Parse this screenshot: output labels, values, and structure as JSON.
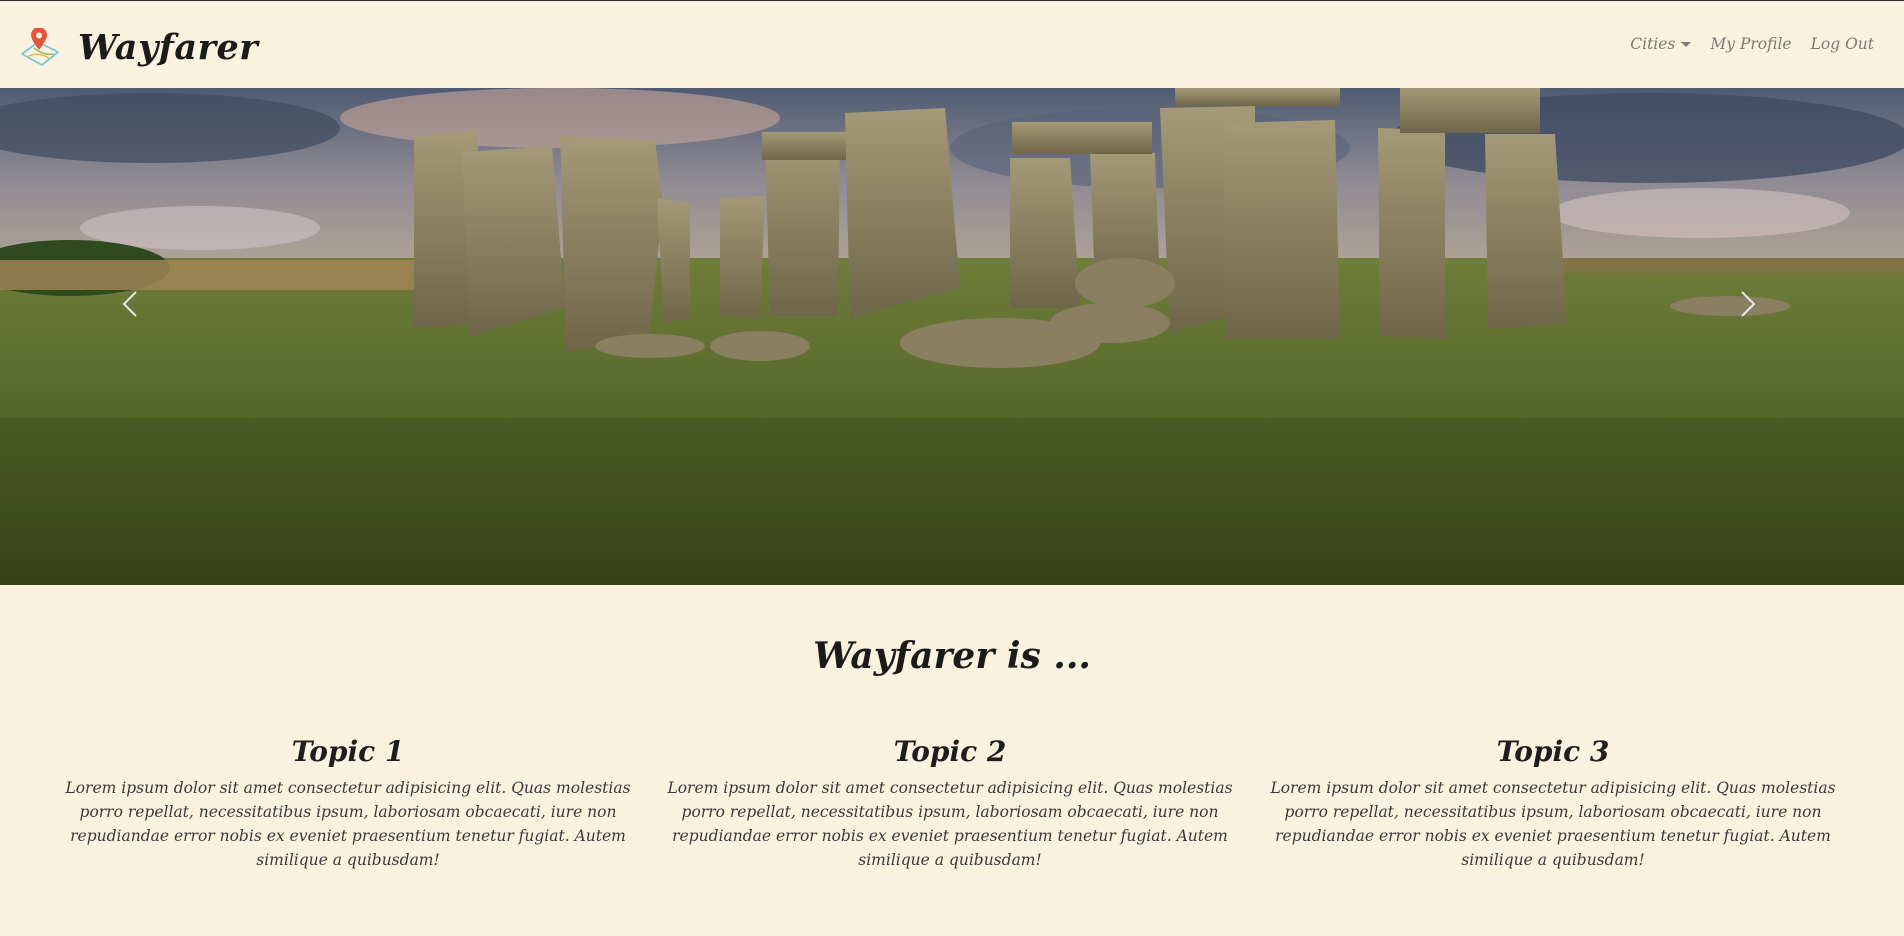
{
  "navbar": {
    "brand": "Wayfarer",
    "logo_icon": "map-pin-icon",
    "links": {
      "cities": "Cities",
      "profile": "My Profile",
      "logout": "Log Out"
    }
  },
  "carousel": {
    "image": "stonehenge-landscape",
    "prev_icon": "chevron-left-icon",
    "next_icon": "chevron-right-icon"
  },
  "about": {
    "title": "Wayfarer is ...",
    "topics": [
      {
        "title": "Topic 1",
        "text": "Lorem ipsum dolor sit amet consectetur adipisicing elit. Quas molestias porro repellat, necessitatibus ipsum, laboriosam obcaecati, iure non repudiandae error nobis ex eveniet praesentium tenetur fugiat. Autem similique a quibusdam!"
      },
      {
        "title": "Topic 2",
        "text": "Lorem ipsum dolor sit amet consectetur adipisicing elit. Quas molestias porro repellat, necessitatibus ipsum, laboriosam obcaecati, iure non repudiandae error nobis ex eveniet praesentium tenetur fugiat. Autem similique a quibusdam!"
      },
      {
        "title": "Topic 3",
        "text": "Lorem ipsum dolor sit amet consectetur adipisicing elit. Quas molestias porro repellat, necessitatibus ipsum, laboriosam obcaecati, iure non repudiandae error nobis ex eveniet praesentium tenetur fugiat. Autem similique a quibusdam!"
      }
    ]
  },
  "colors": {
    "background": "#f9f2df",
    "text": "#1b1b1b",
    "nav_link": "#7c7a74"
  }
}
